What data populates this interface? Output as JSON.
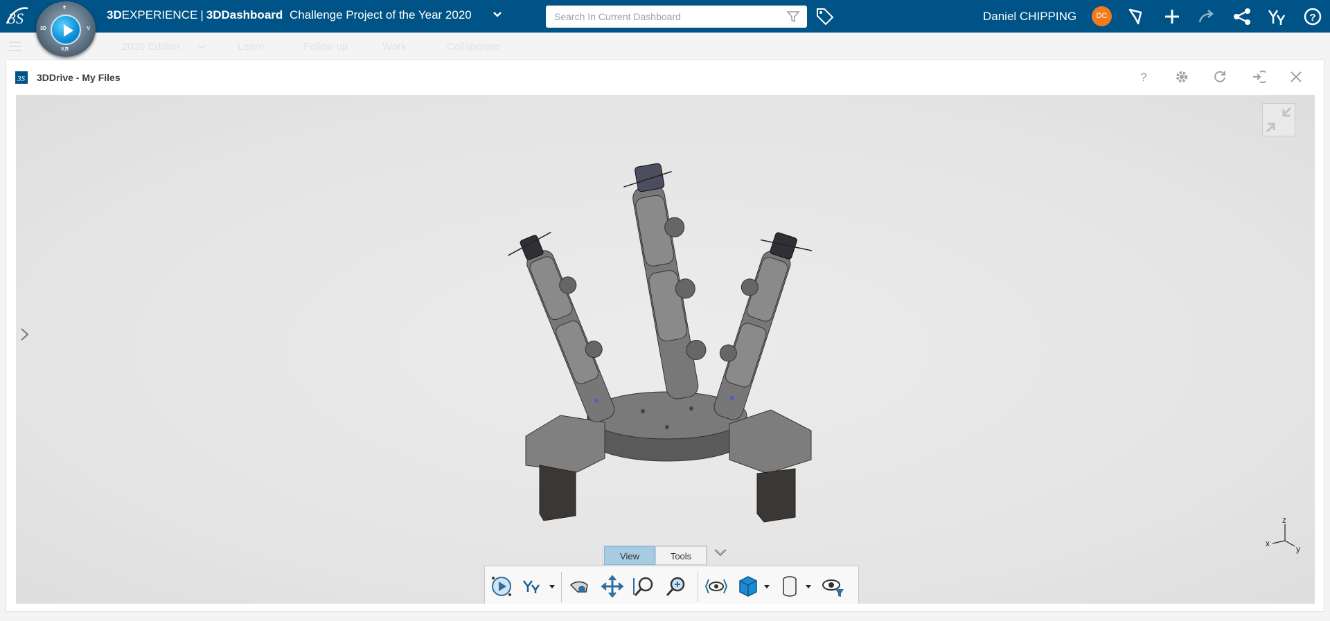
{
  "topbar": {
    "brand_bold": "3D",
    "brand_rest": "EXPERIENCE",
    "brand_sep": "|",
    "brand_app": "3DDashboard",
    "dashboard_title": "Challenge Project of the Year 2020",
    "search_placeholder": "Search In Current Dashboard",
    "user_name": "Daniel CHIPPING",
    "user_initials": "DC",
    "compass_labels": {
      "left": "3D",
      "right": "V",
      "bottom": "V,R"
    },
    "colors": {
      "bar": "#005386",
      "avatar": "#f47a20"
    }
  },
  "subbar": {
    "tabs": [
      "2020 Edition",
      "Learn",
      "Follow up",
      "Work",
      "Collaborate"
    ]
  },
  "widget": {
    "title": "3DDrive - My Files"
  },
  "viewer": {
    "axis": {
      "x": "x",
      "y": "y",
      "z": "z"
    },
    "tabs": [
      {
        "label": "View",
        "active": true
      },
      {
        "label": "Tools",
        "active": false
      }
    ],
    "toolbar_icons": [
      "play-experience-icon",
      "compass-ribbon-icon",
      "fly-mode-icon",
      "pan-icon",
      "zoom-area-icon",
      "zoom-in-icon",
      "look-at-icon",
      "view-cube-icon",
      "render-style-icon",
      "visibility-filter-icon"
    ]
  }
}
